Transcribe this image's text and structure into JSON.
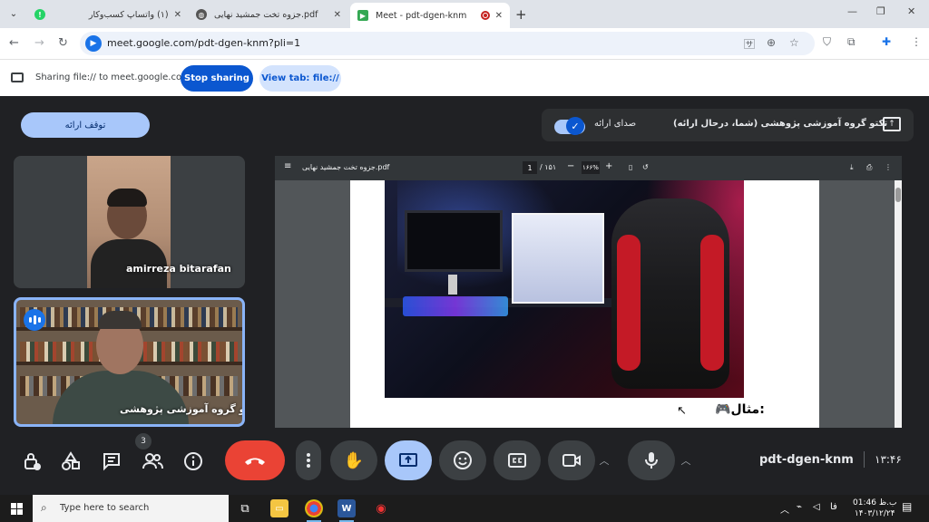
{
  "browser": {
    "tabs": [
      {
        "title": "(۱) واتساپ کسب‌وکار",
        "favicon": "whatsapp-icon",
        "active": false
      },
      {
        "title": "جزوه تخت جمشید نهایی.pdf",
        "favicon": "pdf-icon",
        "active": false
      },
      {
        "title": "Meet - pdt-dgen-knm",
        "favicon": "meet-icon",
        "active": true
      }
    ],
    "url": "meet.google.com/pdt-dgen-knm?pli=1"
  },
  "sharing_bar": {
    "text": "Sharing file:// to meet.google.com",
    "stop_label": "Stop sharing",
    "view_label": "View tab: file://"
  },
  "meet": {
    "stop_presenting_label": "توقف ارائه",
    "presentation_audio_label": "صدای ارائه",
    "presentation_title": "تکتو گروه آموزشی پژوهشی (شما، درحال ارائه)",
    "participants": [
      {
        "name": "amirreza bitarafan"
      },
      {
        "name": "تکتو گروه آموزشی پژوهشی"
      }
    ],
    "participant_count": "3",
    "meeting_code": "pdt-dgen-knm",
    "time": "۱۳:۴۶"
  },
  "pdf_viewer": {
    "file_name": "جزوه تخت جمشید نهایی.pdf",
    "current_page": "1",
    "total_pages": "/ ۱۵۱",
    "zoom": "۱۶۶%",
    "caption": "🎮مثال:"
  },
  "taskbar": {
    "search_placeholder": "Type here to search",
    "lang": "فا",
    "clock_time": "01:46 ب.ظ",
    "clock_date": "۱۴۰۳/۱۲/۲۴"
  },
  "colors": {
    "stop_sharing_bg": "#0b57d0",
    "hangup_red": "#ea4335",
    "present_blue": "#a8c7fa"
  }
}
